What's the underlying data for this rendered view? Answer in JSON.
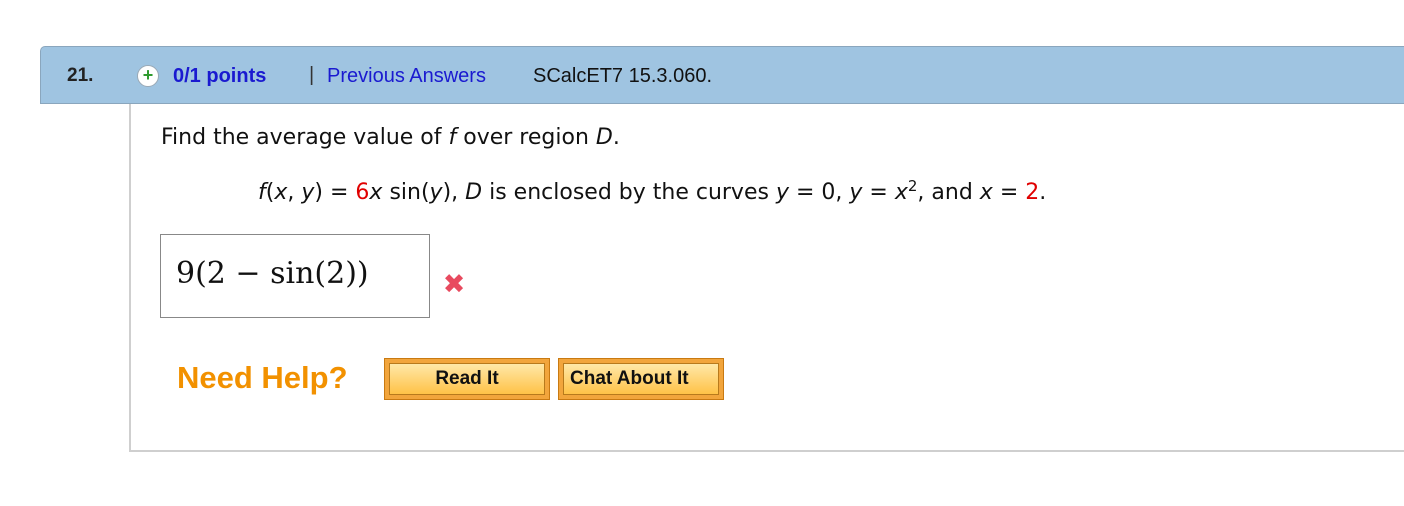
{
  "question": {
    "number": "21.",
    "status_icon": "plus-icon",
    "points": "0/1 points",
    "separator": "|",
    "previous_answers": "Previous Answers",
    "source": "SCalcET7 15.3.060."
  },
  "prompt": {
    "prefix": "Find the average value of ",
    "f_var": "f",
    "middle": " over region ",
    "d_var": "D",
    "suffix": "."
  },
  "equation": {
    "p1": "f",
    "p2": "(",
    "p3": "x",
    "p4": ", ",
    "p5": "y",
    "p6": ") = ",
    "coef": "6",
    "p7": "x",
    "p8": " sin(",
    "p9": "y",
    "p10": "),  ",
    "p11": "D",
    "p12": " is enclosed by the curves ",
    "p13": "y",
    "p14": " = 0,  ",
    "p15": "y",
    "p16": " = ",
    "p17": "x",
    "exp": "2",
    "p18": ",  and ",
    "p19": "x",
    "p20": " = ",
    "limit": "2",
    "p21": "."
  },
  "answer": {
    "value": "9(2 − sin(2))",
    "result_icon": "incorrect-x-icon"
  },
  "help": {
    "label": "Need Help?",
    "read_button": "Read It",
    "chat_button": "Chat About It"
  },
  "colors": {
    "header_bg": "#9fc4e1",
    "link": "#1a1ad0",
    "emphasis_red": "#e00000",
    "help_orange": "#f29100",
    "incorrect": "#e84a5f"
  }
}
